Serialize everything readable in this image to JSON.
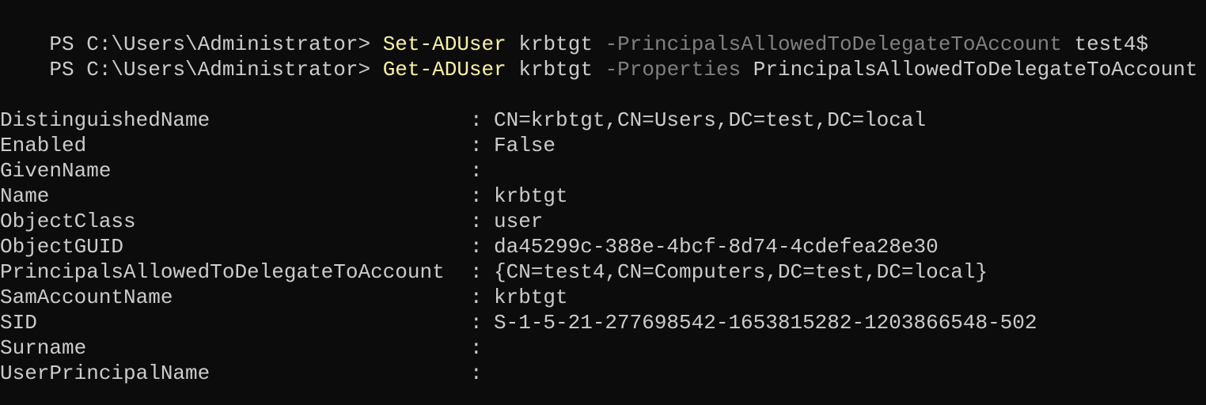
{
  "colors": {
    "background": "#0c0c0c",
    "text": "#cccccc",
    "cmdlet": "#f9f1a5",
    "parameter": "#808080"
  },
  "commands": [
    {
      "prompt": "PS C:\\Users\\Administrator> ",
      "cmdlet": "Set-ADUser",
      "arg1": " krbtgt ",
      "param": "-PrincipalsAllowedToDelegateToAccount",
      "arg2": " test4$"
    },
    {
      "prompt": "PS C:\\Users\\Administrator> ",
      "cmdlet": "Get-ADUser",
      "arg1": " krbtgt ",
      "param": "-Properties",
      "arg2": " PrincipalsAllowedToDelegateToAccount"
    }
  ],
  "separator": ":",
  "properties": [
    {
      "name": "DistinguishedName",
      "value": "CN=krbtgt,CN=Users,DC=test,DC=local"
    },
    {
      "name": "Enabled",
      "value": "False"
    },
    {
      "name": "GivenName",
      "value": ""
    },
    {
      "name": "Name",
      "value": "krbtgt"
    },
    {
      "name": "ObjectClass",
      "value": "user"
    },
    {
      "name": "ObjectGUID",
      "value": "da45299c-388e-4bcf-8d74-4cdefea28e30"
    },
    {
      "name": "PrincipalsAllowedToDelegateToAccount",
      "value": "{CN=test4,CN=Computers,DC=test,DC=local}"
    },
    {
      "name": "SamAccountName",
      "value": "krbtgt"
    },
    {
      "name": "SID",
      "value": "S-1-5-21-277698542-1653815282-1203866548-502"
    },
    {
      "name": "Surname",
      "value": ""
    },
    {
      "name": "UserPrincipalName",
      "value": ""
    }
  ]
}
